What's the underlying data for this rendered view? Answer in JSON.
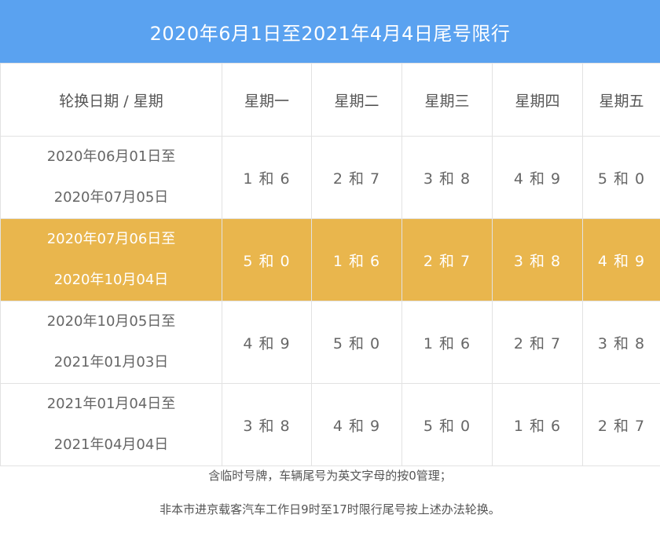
{
  "title": "2020年6月1日至2021年4月4日尾号限行",
  "colors": {
    "title_bar": "#5aa2f0",
    "highlight_row": "#e9b64d"
  },
  "table": {
    "header": {
      "period_label": "轮换日期 / 星期",
      "days": [
        "星期一",
        "星期二",
        "星期三",
        "星期四",
        "星期五"
      ]
    },
    "rows": [
      {
        "period_start": "2020年06月01日至",
        "period_end": "2020年07月05日",
        "plates": [
          "1 和 6",
          "2 和 7",
          "3 和 8",
          "4 和 9",
          "5 和 0"
        ],
        "highlighted": false
      },
      {
        "period_start": "2020年07月06日至",
        "period_end": "2020年10月04日",
        "plates": [
          "5 和 0",
          "1 和 6",
          "2 和 7",
          "3 和 8",
          "4 和 9"
        ],
        "highlighted": true
      },
      {
        "period_start": "2020年10月05日至",
        "period_end": "2021年01月03日",
        "plates": [
          "4 和 9",
          "5 和 0",
          "1 和 6",
          "2 和 7",
          "3 和 8"
        ],
        "highlighted": false
      },
      {
        "period_start": "2021年01月04日至",
        "period_end": "2021年04月04日",
        "plates": [
          "3 和 8",
          "4 和 9",
          "5 和 0",
          "1 和 6",
          "2 和 7"
        ],
        "highlighted": false
      }
    ]
  },
  "notes": [
    "含临时号牌，车辆尾号为英文字母的按0管理；",
    "非本市进京载客汽车工作日9时至17时限行尾号按上述办法轮换。"
  ]
}
